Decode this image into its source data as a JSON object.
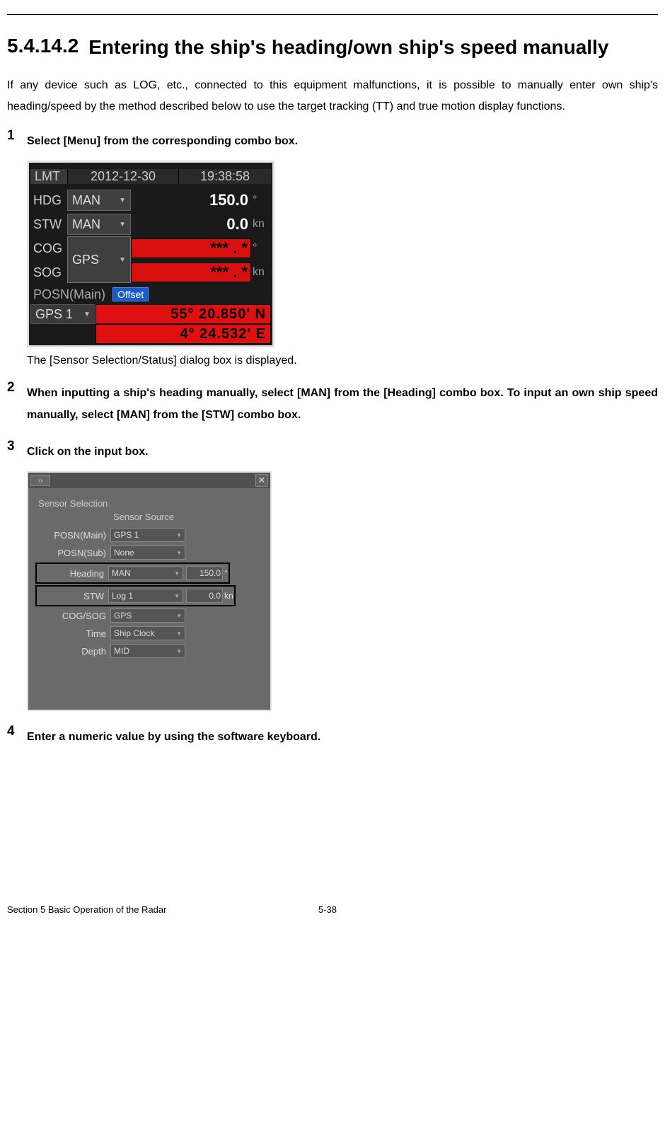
{
  "heading": {
    "number": "5.4.14.2",
    "title": "Entering the ship's heading/own ship's speed manually"
  },
  "intro": "If any device such as LOG, etc., connected to this equipment malfunctions, it is possible to manually enter own ship's heading/speed by the method described below to use the target tracking (TT) and true motion display functions.",
  "steps": [
    {
      "num": "1",
      "title": "Select [Menu] from the corresponding combo box.",
      "after": "The [Sensor Selection/Status] dialog box is displayed."
    },
    {
      "num": "2",
      "title": "When inputting a ship's heading manually, select [MAN] from the [Heading] combo box. To input an own ship speed manually, select [MAN] from the [STW] combo box."
    },
    {
      "num": "3",
      "title": "Click on the input box."
    },
    {
      "num": "4",
      "title": "Enter a numeric value by using the software keyboard."
    }
  ],
  "panel1": {
    "lmt": "LMT",
    "date": "2012-12-30",
    "time": "19:38:58",
    "hdg_label": "HDG",
    "hdg_sel": "MAN",
    "hdg_val": "150.0",
    "hdg_unit": "°",
    "stw_label": "STW",
    "stw_sel": "MAN",
    "stw_val": "0.0",
    "stw_unit": "kn",
    "cog_label": "COG",
    "cogsog_sel": "GPS",
    "cog_val": "*** . *",
    "cog_unit": "°",
    "sog_label": "SOG",
    "sog_val": "*** . *",
    "sog_unit": "kn",
    "posn_label": "POSN(Main)",
    "offset": "Offset",
    "pos_sel": "GPS 1",
    "lat": "55° 20.850' N",
    "lon": "4° 24.532' E"
  },
  "panel2": {
    "pin": "››",
    "fieldset": "Sensor Selection",
    "subhead": "Sensor Source",
    "rows": {
      "posn_main": {
        "label": "POSN(Main)",
        "sel": "GPS 1"
      },
      "posn_sub": {
        "label": "POSN(Sub)",
        "sel": "None"
      },
      "heading": {
        "label": "Heading",
        "sel": "MAN",
        "val": "150.0",
        "unit": "°"
      },
      "stw": {
        "label": "STW",
        "sel": "Log 1",
        "val": "0.0",
        "unit": "kn"
      },
      "cogsog": {
        "label": "COG/SOG",
        "sel": "GPS"
      },
      "time": {
        "label": "Time",
        "sel": "Ship Clock"
      },
      "depth": {
        "label": "Depth",
        "sel": "MID"
      }
    }
  },
  "footer": {
    "left": "Section 5    Basic Operation of the Radar",
    "mid": "5-38"
  }
}
